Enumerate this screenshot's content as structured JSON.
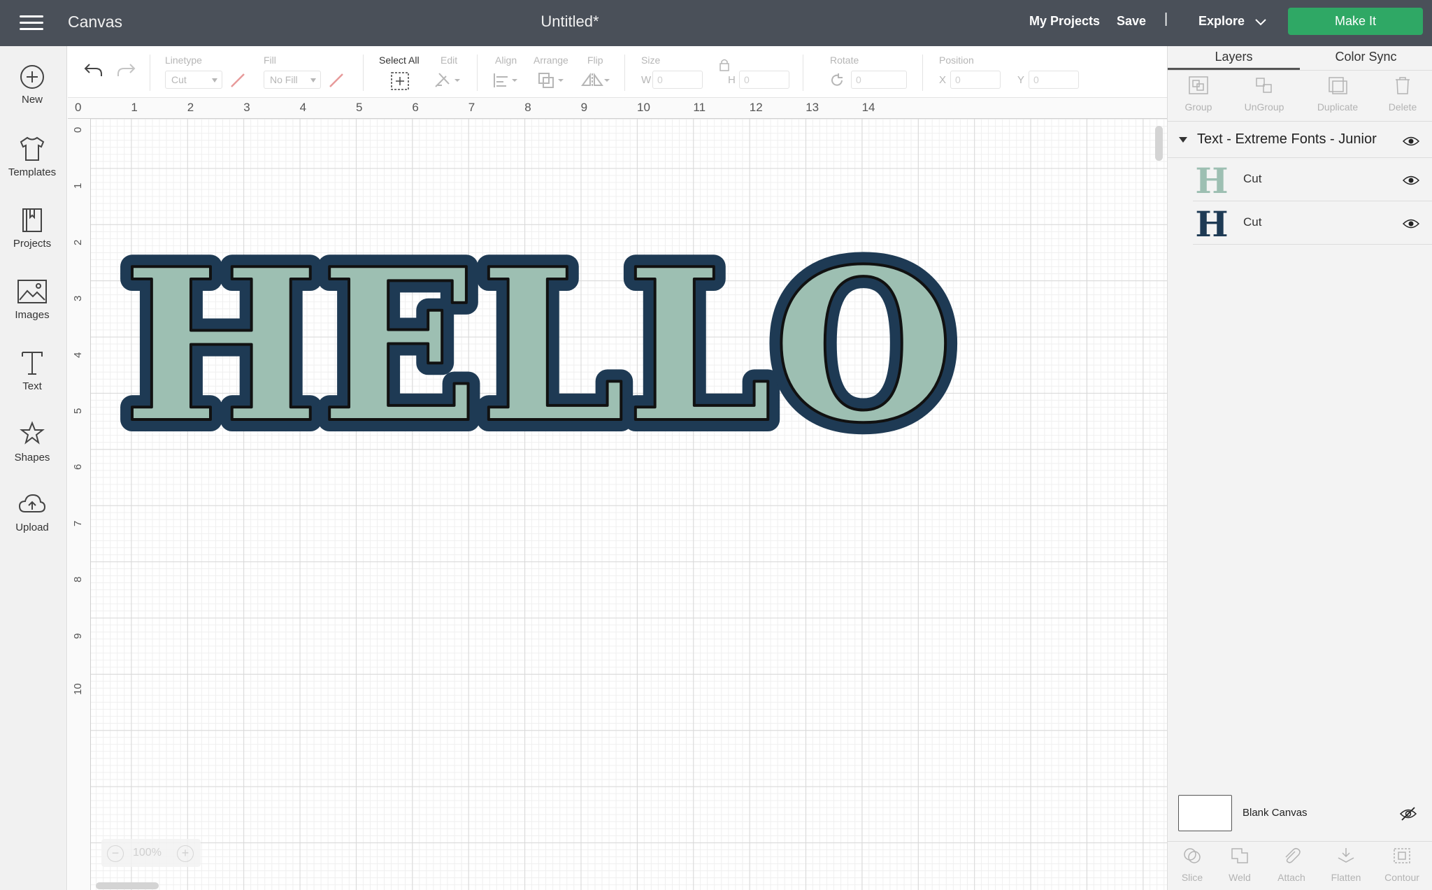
{
  "topbar": {
    "app_title": "Canvas",
    "doc_title": "Untitled*",
    "my_projects": "My Projects",
    "save": "Save",
    "divider": "|",
    "explore": "Explore",
    "make_it": "Make It",
    "make_it_color": "#2fa865",
    "bar_color": "#4a5059"
  },
  "sidebar": {
    "items": [
      {
        "label": "New",
        "icon": "plus-circle-icon"
      },
      {
        "label": "Templates",
        "icon": "tshirt-icon"
      },
      {
        "label": "Projects",
        "icon": "book-icon"
      },
      {
        "label": "Images",
        "icon": "image-icon"
      },
      {
        "label": "Text",
        "icon": "text-T-icon"
      },
      {
        "label": "Shapes",
        "icon": "shapes-icon"
      },
      {
        "label": "Upload",
        "icon": "cloud-upload-icon"
      }
    ]
  },
  "toolbar": {
    "linetype_label": "Linetype",
    "linetype_value": "Cut",
    "fill_label": "Fill",
    "fill_value": "No Fill",
    "select_all": "Select All",
    "edit": "Edit",
    "align": "Align",
    "arrange": "Arrange",
    "flip": "Flip",
    "size": "Size",
    "w_letter": "W",
    "w_value": "0",
    "h_letter": "H",
    "h_value": "0",
    "rotate": "Rotate",
    "rotate_value": "0",
    "position": "Position",
    "x_letter": "X",
    "x_value": "0",
    "y_letter": "Y",
    "y_value": "0"
  },
  "rulers": {
    "horizontal": [
      "0",
      "1",
      "2",
      "3",
      "4",
      "5",
      "6",
      "7",
      "8",
      "9",
      "10",
      "11",
      "12",
      "13",
      "14"
    ],
    "vertical": [
      "0",
      "1",
      "2",
      "3",
      "4",
      "5",
      "6",
      "7",
      "8",
      "9",
      "10"
    ]
  },
  "canvas": {
    "text": "HELLO",
    "fill_color": "#9dbfb2",
    "outline_color": "#1e3a54",
    "zoom": "100%"
  },
  "layers_panel": {
    "tabs": [
      "Layers",
      "Color Sync"
    ],
    "actions": [
      "Group",
      "UnGroup",
      "Duplicate",
      "Delete"
    ],
    "group_name": "Text - Extreme Fonts - Junior",
    "layers": [
      {
        "name": "Cut",
        "thumb_color": "#9dbfb2"
      },
      {
        "name": "Cut",
        "thumb_color": "#1e3a54"
      }
    ],
    "blank_canvas": "Blank Canvas",
    "bottom_actions": [
      "Slice",
      "Weld",
      "Attach",
      "Flatten",
      "Contour"
    ]
  }
}
